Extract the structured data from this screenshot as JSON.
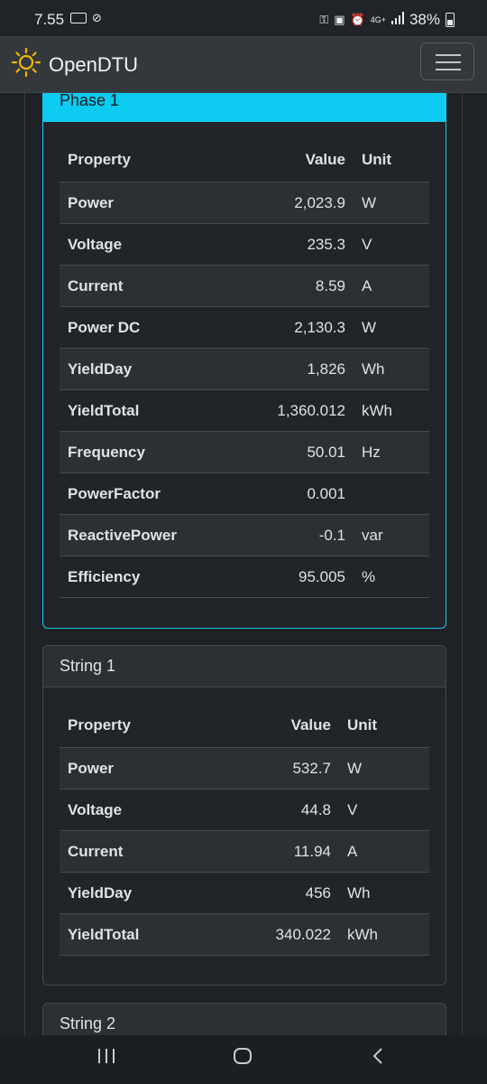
{
  "status_bar": {
    "time": "7.55",
    "network": "4G+",
    "battery": "38%"
  },
  "navbar": {
    "brand": "OpenDTU"
  },
  "phase1": {
    "title": "Phase 1",
    "headers": {
      "property": "Property",
      "value": "Value",
      "unit": "Unit"
    },
    "rows": [
      {
        "property": "Power",
        "value": "2,023.9",
        "unit": "W"
      },
      {
        "property": "Voltage",
        "value": "235.3",
        "unit": "V"
      },
      {
        "property": "Current",
        "value": "8.59",
        "unit": "A"
      },
      {
        "property": "Power DC",
        "value": "2,130.3",
        "unit": "W"
      },
      {
        "property": "YieldDay",
        "value": "1,826",
        "unit": "Wh"
      },
      {
        "property": "YieldTotal",
        "value": "1,360.012",
        "unit": "kWh"
      },
      {
        "property": "Frequency",
        "value": "50.01",
        "unit": "Hz"
      },
      {
        "property": "PowerFactor",
        "value": "0.001",
        "unit": ""
      },
      {
        "property": "ReactivePower",
        "value": "-0.1",
        "unit": "var"
      },
      {
        "property": "Efficiency",
        "value": "95.005",
        "unit": "%"
      }
    ]
  },
  "string1": {
    "title": "String 1",
    "headers": {
      "property": "Property",
      "value": "Value",
      "unit": "Unit"
    },
    "rows": [
      {
        "property": "Power",
        "value": "532.7",
        "unit": "W"
      },
      {
        "property": "Voltage",
        "value": "44.8",
        "unit": "V"
      },
      {
        "property": "Current",
        "value": "11.94",
        "unit": "A"
      },
      {
        "property": "YieldDay",
        "value": "456",
        "unit": "Wh"
      },
      {
        "property": "YieldTotal",
        "value": "340.022",
        "unit": "kWh"
      }
    ]
  },
  "string2": {
    "title": "String 2"
  },
  "colors": {
    "accent": "#0dcaf0",
    "brand_icon": "#f0b400",
    "background": "#1e2125"
  },
  "icons": {
    "brand": "sun-icon",
    "menu": "hamburger-icon",
    "nav_recents": "recents-icon",
    "nav_home": "home-icon",
    "nav_back": "back-icon"
  }
}
